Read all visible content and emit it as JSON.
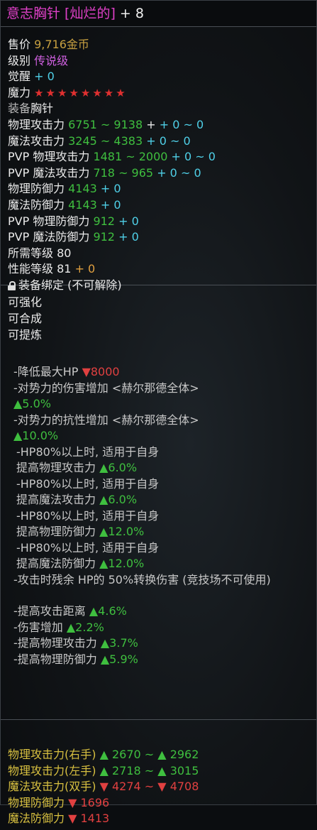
{
  "title": {
    "name": "意志胸针 [灿烂的]",
    "enhance": "+ 8"
  },
  "basic": {
    "price_label": "售价",
    "price_value": "9,716金币",
    "grade_label": "级别",
    "grade_value": "传说级",
    "awaken_label": "觉醒",
    "awaken_value": "+ 0",
    "magic_label": "魔力",
    "magic_stars": "★★★★★★★★",
    "equip_label": "装备",
    "equip_value": "胸针"
  },
  "stats": [
    {
      "label": "物理攻击力",
      "value": "6751 ~ 9138",
      "bonus": "+ 0 ~ 0"
    },
    {
      "label": "魔法攻击力",
      "value": "3245 ~ 4383",
      "bonus": "+ 0 ~ 0"
    },
    {
      "label": "PVP 物理攻击力",
      "value": "1481 ~ 2000",
      "bonus": "+ 0 ~ 0"
    },
    {
      "label": "PVP 魔法攻击力",
      "value": "718 ~ 965",
      "bonus": "+ 0 ~ 0"
    },
    {
      "label": "物理防御力",
      "value": "4143",
      "bonus": "+ 0"
    },
    {
      "label": "魔法防御力",
      "value": "4143",
      "bonus": "+ 0"
    },
    {
      "label": "PVP 物理防御力",
      "value": "912",
      "bonus": "+ 0"
    },
    {
      "label": "PVP 魔法防御力",
      "value": "912",
      "bonus": "+ 0"
    }
  ],
  "req": {
    "level_label": "所需等级",
    "level_value": "80",
    "perf_label": "性能等级",
    "perf_value": "81",
    "perf_bonus": "+ 0",
    "bind_text": "装备绑定 (不可解除)"
  },
  "flags": [
    "可强化",
    "可合成",
    "可提炼"
  ],
  "options": {
    "o1_label": "-降低最大HP",
    "o1_value": "▼8000",
    "o2_label": "-对势力的伤害增加 <赫尔那德全体>",
    "o2_value": "▲5.0%",
    "o3_label": "-对势力的抗性增加 <赫尔那德全体>",
    "o3_value": "▲10.0%",
    "hp_cond": "-HP80%以上时, 适用于自身",
    "o4_label": "提高物理攻击力",
    "o4_value": "▲6.0%",
    "o5_label": "提高魔法攻击力",
    "o5_value": "▲6.0%",
    "o6_label": "提高物理防御力",
    "o6_value": "▲12.0%",
    "o7_label": "提高魔法防御力",
    "o7_value": "▲12.0%",
    "o8_text": "-攻击时残余 HP的 50%转换伤害 (竞技场不可使用)",
    "o9_label": "-提高攻击距离",
    "o9_value": "▲4.6%",
    "o10_label": "-伤害增加",
    "o10_value": "▲2.2%",
    "o11_label": "-提高物理攻击力",
    "o11_value": "▲3.7%",
    "o12_label": "-提高物理防御力",
    "o12_value": "▲5.9%"
  },
  "compare": [
    {
      "label": "物理攻击力(右手)",
      "v1": "▲ 2670",
      "sep": "~",
      "v2": "▲ 2962"
    },
    {
      "label": "物理攻击力(左手)",
      "v1": "▲ 2718",
      "sep": "~",
      "v2": "▲ 3015"
    },
    {
      "label": "魔法攻击力(双手)",
      "v1": "▼ 4274",
      "sep": "~",
      "v2": "▼ 4708"
    },
    {
      "label": "物理防御力",
      "v1": "▼ 1696"
    },
    {
      "label": "魔法防御力",
      "v1": "▼ 1413"
    }
  ],
  "colors": {
    "title": "#e040c8",
    "positive": "#3fbf3f",
    "negative": "#e04040",
    "cyan": "#4fd0e8",
    "gold": "#c8a040",
    "legendary": "#d060e0"
  }
}
